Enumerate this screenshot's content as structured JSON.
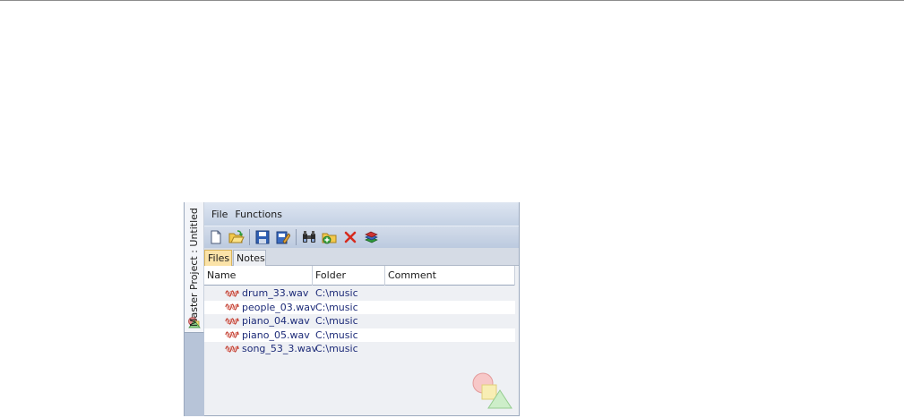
{
  "side_panel": {
    "title": "Master Project : Untitled",
    "icon": "shapes-icon"
  },
  "menubar": {
    "items": [
      "File",
      "Functions"
    ]
  },
  "toolbar": {
    "buttons": [
      "new-icon",
      "open-icon",
      "save-icon",
      "edit-icon",
      "find-icon",
      "add-folder-icon",
      "delete-icon",
      "library-icon"
    ]
  },
  "tabs": {
    "files": "Files",
    "notes": "Notes",
    "active": "Files"
  },
  "file_list": {
    "columns": [
      "Name",
      "Folder",
      "Comment"
    ],
    "rows": [
      {
        "name": "drum_33.wav",
        "folder": "C:\\music",
        "comment": ""
      },
      {
        "name": "people_03.wav",
        "folder": "C:\\music",
        "comment": ""
      },
      {
        "name": "piano_04.wav",
        "folder": "C:\\music",
        "comment": ""
      },
      {
        "name": "piano_05.wav",
        "folder": "C:\\music",
        "comment": ""
      },
      {
        "name": "song_53_3.wav",
        "folder": "C:\\music",
        "comment": ""
      }
    ]
  },
  "colors": {
    "accent_tab": "#fbe3a8",
    "file_text": "#1d2b78",
    "wave_icon": "#c0392b"
  }
}
